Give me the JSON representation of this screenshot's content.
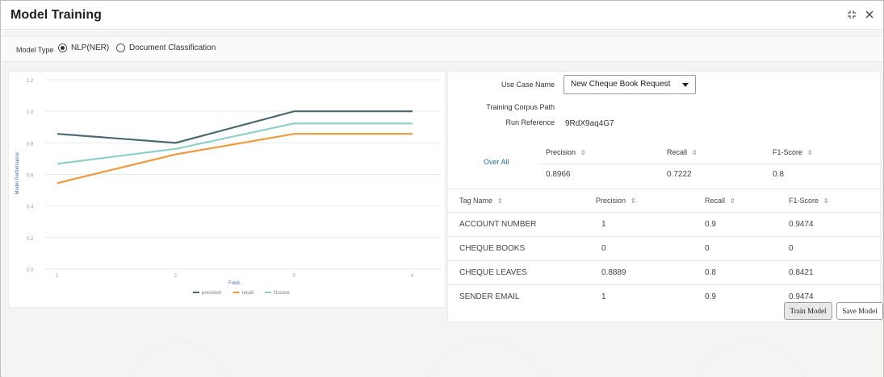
{
  "window": {
    "title": "Model Training",
    "icons": [
      "collapse-icon",
      "close-icon"
    ]
  },
  "model_type": {
    "label": "Model Type",
    "options": [
      {
        "label": "NLP(NER)",
        "selected": true
      },
      {
        "label": "Document Classification",
        "selected": false
      }
    ]
  },
  "chart_data": {
    "type": "line",
    "x": [
      1,
      2,
      3,
      4
    ],
    "xlabel": "Folds",
    "ylabel": "Model Performance",
    "ylim": [
      0.0,
      1.2
    ],
    "yticks": [
      "0.0",
      "0.2",
      "0.4",
      "0.6",
      "0.8",
      "1.0",
      "1.2"
    ],
    "xticks": [
      "1",
      "2",
      "3",
      "4"
    ],
    "grid": true,
    "legend_position": "bottom",
    "series": [
      {
        "name": "precision",
        "color": "#4a6a6e",
        "values": [
          0.857,
          0.8,
          1.0,
          1.0
        ]
      },
      {
        "name": "recall",
        "color": "#ef9a3c",
        "values": [
          0.545,
          0.727,
          0.857,
          0.857
        ]
      },
      {
        "name": "f1score",
        "color": "#8fd1c9",
        "values": [
          0.667,
          0.762,
          0.923,
          0.923
        ]
      }
    ]
  },
  "form": {
    "use_case_label": "Use Case Name",
    "use_case_value": "New Cheque Book Request",
    "corpus_label": "Training Corpus Path",
    "run_ref_label": "Run Reference",
    "run_ref_value": "9RdX9aq4G7"
  },
  "overall": {
    "link": "Over All",
    "headers": [
      "Precision",
      "Recall",
      "F1-Score"
    ],
    "values": [
      "0.8966",
      "0.7222",
      "0.8"
    ]
  },
  "tags": {
    "headers": [
      "Tag Name",
      "Precision",
      "Recall",
      "F1-Score"
    ],
    "rows": [
      [
        "ACCOUNT NUMBER",
        "1",
        "0.9",
        "0.9474"
      ],
      [
        "CHEQUE BOOKS",
        "0",
        "0",
        "0"
      ],
      [
        "CHEQUE LEAVES",
        "0.8889",
        "0.8",
        "0.8421"
      ],
      [
        "SENDER EMAIL",
        "1",
        "0.9",
        "0.9474"
      ]
    ]
  },
  "buttons": {
    "train": "Train Model",
    "save": "Save Model"
  },
  "sort_glyph": "⇳"
}
